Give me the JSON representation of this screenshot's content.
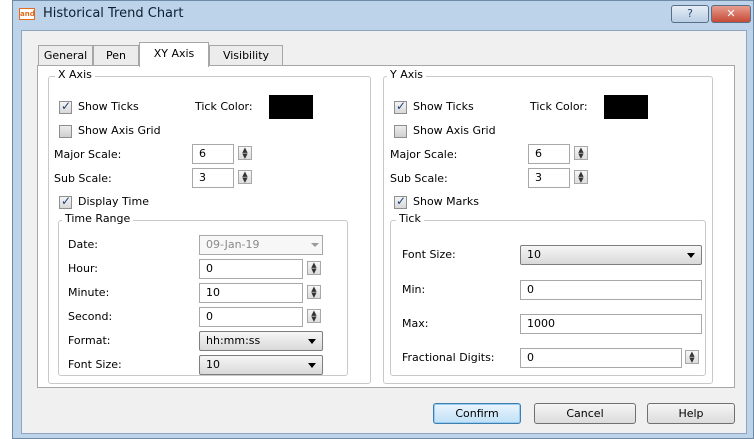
{
  "window": {
    "app_icon": "and",
    "title": "Historical Trend Chart",
    "help_glyph": "?",
    "close_glyph": "✕"
  },
  "tabs": [
    {
      "label": "General",
      "active": false
    },
    {
      "label": "Pen",
      "active": false
    },
    {
      "label": "XY Axis",
      "active": true
    },
    {
      "label": "Visibility",
      "active": false
    }
  ],
  "x_axis": {
    "title": "X Axis",
    "show_ticks_label": "Show Ticks",
    "show_ticks": true,
    "tick_color_label": "Tick Color:",
    "tick_color": "#000000",
    "show_axis_grid_label": "Show Axis Grid",
    "show_axis_grid": false,
    "major_scale_label": "Major Scale:",
    "major_scale": "6",
    "sub_scale_label": "Sub Scale:",
    "sub_scale": "3",
    "display_time_label": "Display Time",
    "display_time": true,
    "time_range": {
      "title": "Time Range",
      "date_label": "Date:",
      "date_value": "09-Jan-19",
      "hour_label": "Hour:",
      "hour_value": "0",
      "minute_label": "Minute:",
      "minute_value": "10",
      "second_label": "Second:",
      "second_value": "0",
      "format_label": "Format:",
      "format_value": "hh:mm:ss",
      "font_size_label": "Font Size:",
      "font_size_value": "10"
    }
  },
  "y_axis": {
    "title": "Y Axis",
    "show_ticks_label": "Show Ticks",
    "show_ticks": true,
    "tick_color_label": "Tick Color:",
    "tick_color": "#000000",
    "show_axis_grid_label": "Show Axis Grid",
    "show_axis_grid": false,
    "major_scale_label": "Major Scale:",
    "major_scale": "6",
    "sub_scale_label": "Sub Scale:",
    "sub_scale": "3",
    "show_marks_label": "Show Marks",
    "show_marks": true,
    "tick": {
      "title": "Tick",
      "font_size_label": "Font Size:",
      "font_size_value": "10",
      "min_label": "Min:",
      "min_value": "0",
      "max_label": "Max:",
      "max_value": "1000",
      "fractional_digits_label": "Fractional Digits:",
      "fractional_digits_value": "0"
    }
  },
  "footer": {
    "confirm_label": "Confirm",
    "cancel_label": "Cancel",
    "help_label": "Help"
  },
  "colors": {
    "frame": "#bcd3ea",
    "close_button": "#c64a37",
    "default_button_border": "#3c7fb1"
  }
}
